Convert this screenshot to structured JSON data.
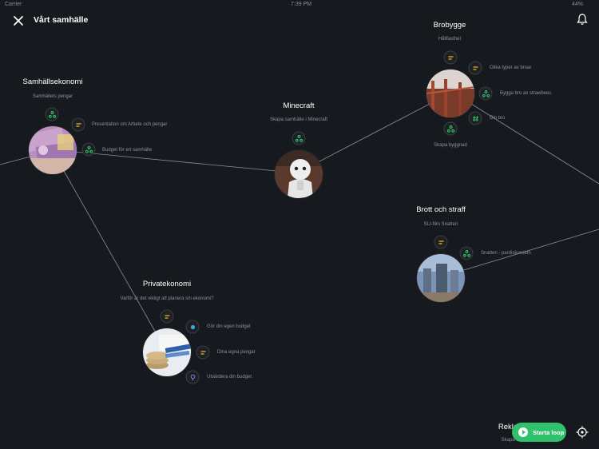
{
  "status_bar": {
    "carrier": "Carrier",
    "time": "7:39 PM",
    "battery": "44%"
  },
  "header": {
    "title": "Vårt samhälle"
  },
  "colors": {
    "background": "#16191d",
    "accent_green": "#2fc26a",
    "teamwork": "#2fc26a",
    "text_task": "#f3c025",
    "quiz": "#2fc26a",
    "poll": "#3ba6e6",
    "idea": "#9b6bdf"
  },
  "topics": [
    {
      "title": "Samhällsekonomi",
      "subtitle": "Samhällets pengar",
      "activities": [
        {
          "icon": "teamwork-icon",
          "label": ""
        },
        {
          "icon": "text-task-icon",
          "label": "Presentation om Arbete och pengar"
        },
        {
          "icon": "teamwork-icon",
          "label": "Budget för ert samhälle"
        }
      ]
    },
    {
      "title": "Minecraft",
      "subtitle": "Skapa samhälle i Minecraft",
      "activities": [
        {
          "icon": "teamwork-icon",
          "label": ""
        }
      ]
    },
    {
      "title": "Brobygge",
      "subtitle": "Hållfasthet",
      "activities": [
        {
          "icon": "text-task-icon",
          "label": ""
        },
        {
          "icon": "text-task-icon",
          "label": "Olika typer av broar"
        },
        {
          "icon": "teamwork-icon",
          "label": "Bygga bro av strawbees"
        },
        {
          "icon": "hashtag-icon",
          "label": "Din bro"
        },
        {
          "icon": "teamwork-icon",
          "label": "Skapa byggnad"
        }
      ]
    },
    {
      "title": "Brott och straff",
      "subtitle": "SLI-film Snatteri",
      "activities": [
        {
          "icon": "text-task-icon",
          "label": ""
        },
        {
          "icon": "teamwork-icon",
          "label": "Snatteri - pardiskussion"
        }
      ]
    },
    {
      "title": "Privatekonomi",
      "subtitle": "Varför är det viktigt att planera sin ekonomi?",
      "activities": [
        {
          "icon": "text-task-icon",
          "label": ""
        },
        {
          "icon": "poll-icon",
          "label": "Gör din egen budget"
        },
        {
          "icon": "text-task-icon",
          "label": "Dina egna pengar"
        },
        {
          "icon": "idea-icon",
          "label": "Utvärdera din budget"
        }
      ]
    },
    {
      "title": "Reklam",
      "subtitle": "Skapa reklam"
    }
  ],
  "buttons": {
    "start_loop": "Starta loop"
  }
}
